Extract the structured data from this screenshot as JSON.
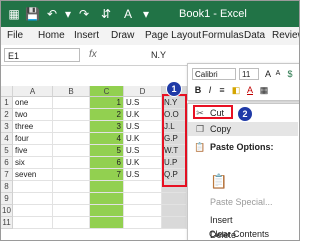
{
  "window": {
    "title": "Book1 - Excel",
    "accent": "#217346"
  },
  "quick_access": [
    "save-icon",
    "undo-icon",
    "redo-icon",
    "sort-icon",
    "font-icon"
  ],
  "ribbon_tabs": [
    "File",
    "Home",
    "Insert",
    "Draw",
    "Page Layout",
    "Formulas",
    "Data",
    "Review"
  ],
  "formula_bar": {
    "name_box": "E1",
    "fx_label": "fx",
    "value": "N.Y"
  },
  "columns": [
    "A",
    "B",
    "C",
    "D",
    "E"
  ],
  "rows": [
    {
      "num": "1",
      "a": "one",
      "c": "1",
      "d": "U.S",
      "e": "N.Y"
    },
    {
      "num": "2",
      "a": "two",
      "c": "2",
      "d": "U.K",
      "e": "O.O"
    },
    {
      "num": "3",
      "a": "three",
      "c": "3",
      "d": "U.S",
      "e": "J.L"
    },
    {
      "num": "4",
      "a": "four",
      "c": "4",
      "d": "U.K",
      "e": "G.P"
    },
    {
      "num": "5",
      "a": "five",
      "c": "5",
      "d": "U.S",
      "e": "W.T"
    },
    {
      "num": "6",
      "a": "six",
      "c": "6",
      "d": "U.K",
      "e": "U.P"
    },
    {
      "num": "7",
      "a": "seven",
      "c": "7",
      "d": "U.S",
      "e": "Q.P"
    },
    {
      "num": "8"
    },
    {
      "num": "9"
    },
    {
      "num": "10"
    },
    {
      "num": "11"
    }
  ],
  "mini_toolbar": {
    "font": "Calibri",
    "size": "11"
  },
  "context_menu": {
    "cut": "Cut",
    "copy": "Copy",
    "paste_options": "Paste Options:",
    "paste_special": "Paste Special...",
    "insert": "Insert",
    "delete": "Delete",
    "clear": "Clear Contents"
  },
  "badges": [
    "1",
    "2"
  ],
  "colors": {
    "green_fill": "#92d050",
    "highlight": "#e81123",
    "badge": "#1f3aa7"
  }
}
